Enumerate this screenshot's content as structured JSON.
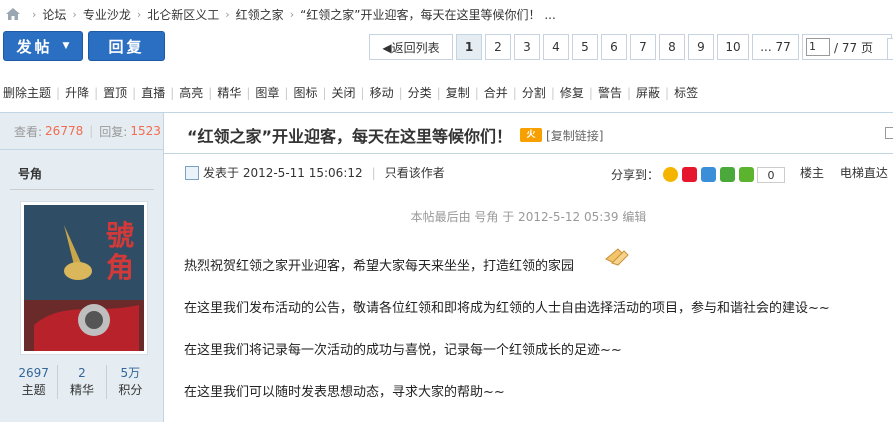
{
  "breadcrumb": {
    "items": [
      "论坛",
      "专业沙龙",
      "北仑新区义工",
      "红领之家",
      "“红领之家”开业迎客，每天在这里等候你们！ ..."
    ]
  },
  "toolbar": {
    "post_label": "发帖",
    "reply_label": "回复"
  },
  "pager": {
    "back_label": "◀返回列表",
    "pages": [
      "1",
      "2",
      "3",
      "4",
      "5",
      "6",
      "7",
      "8",
      "9",
      "10"
    ],
    "current": "1",
    "last_label": "... 77",
    "jump_value": "1",
    "total_label": "/ 77 页"
  },
  "mod_actions": [
    "删除主题",
    "升降",
    "置顶",
    "直播",
    "高亮",
    "精华",
    "图章",
    "图标",
    "关闭",
    "移动",
    "分类",
    "复制",
    "合并",
    "分割",
    "修复",
    "警告",
    "屏蔽",
    "标签"
  ],
  "thread_stats": {
    "views_label": "查看:",
    "views": "26778",
    "replies_label": "回复:",
    "replies": "1523"
  },
  "author": {
    "name": "号角",
    "avatar_text": "號角",
    "stats": [
      {
        "value": "2697",
        "label": "主题"
      },
      {
        "value": "2",
        "label": "精华"
      },
      {
        "value": "5万",
        "label": "积分"
      }
    ]
  },
  "thread": {
    "title": "“红领之家”开业迎客，每天在这里等候你们！",
    "hot_badge": "火",
    "copy_link": "[复制链接]"
  },
  "post": {
    "posted_at": "发表于 2012-5-11 15:06:12",
    "only_author": "只看该作者",
    "share_label": "分享到：",
    "share_count": "0",
    "floor_label": "楼主",
    "goto_label": "电梯直达",
    "edited_note": "本帖最后由 号角 于 2012-5-12 05:39 编辑",
    "paragraphs": [
      "热烈祝贺红领之家开业迎客，希望大家每天来坐坐，打造红领的家园",
      "在这里我们发布活动的公告，敬请各位红领和即将成为红领的人士自由选择活动的项目，参与和谐社会的建设~~",
      "在这里我们将记录每一次活动的成功与喜悦，记录每一个红领成长的足迹~~",
      "在这里我们可以随时发表思想动态，寻求大家的帮助~~"
    ]
  },
  "colors": {
    "accent": "#2b6fc2",
    "side_bg": "#e5edf2",
    "border": "#c2d5e3",
    "stat_value": "#f26c4f",
    "link_blue": "#336699"
  }
}
